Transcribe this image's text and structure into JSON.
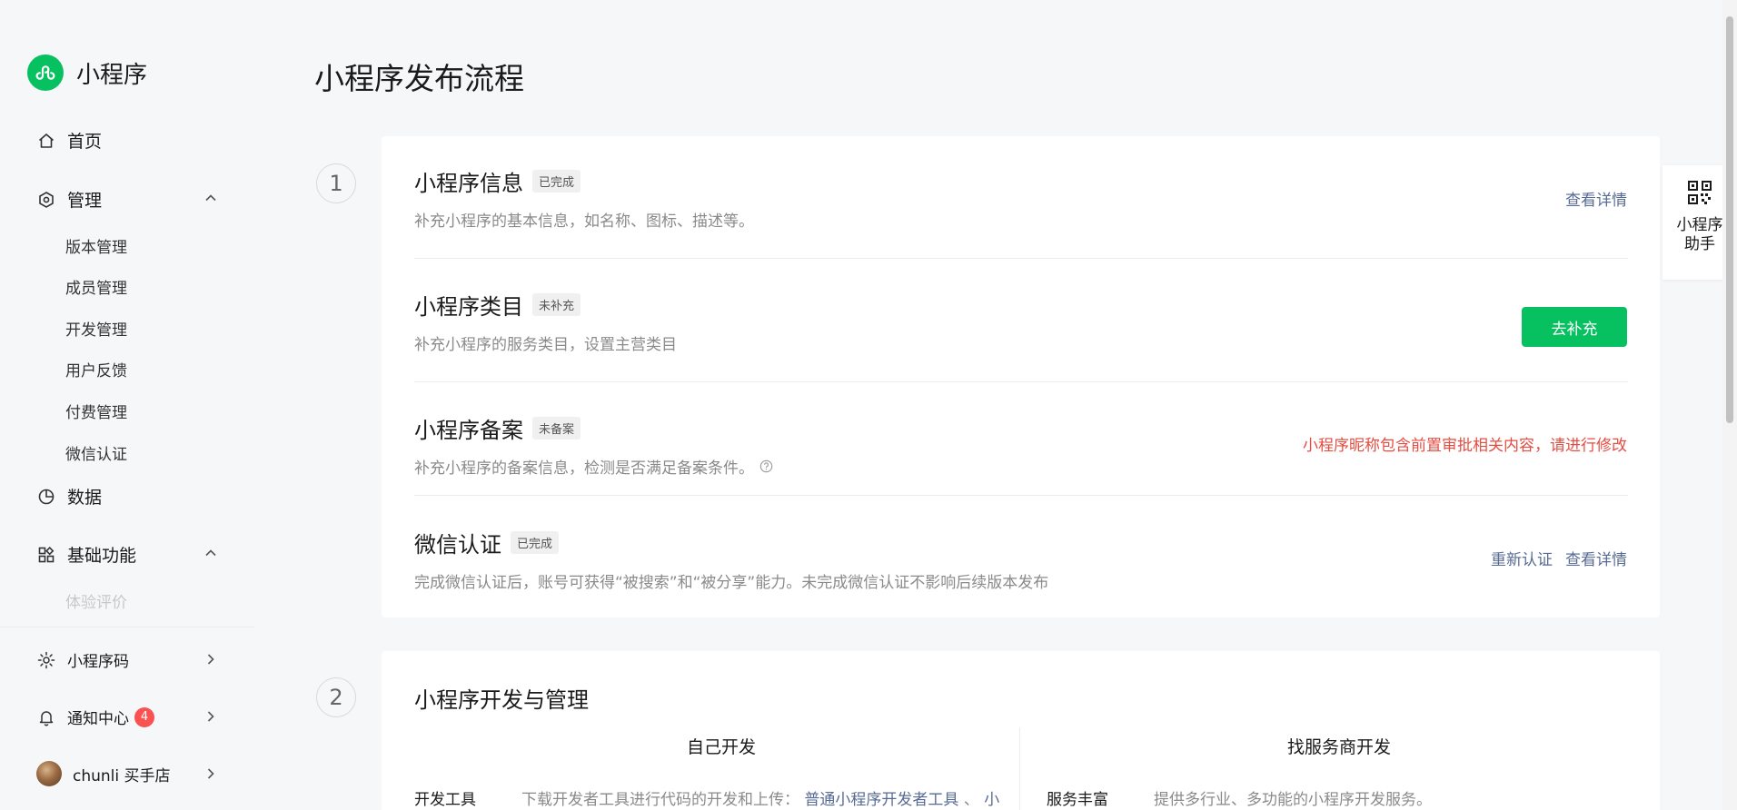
{
  "sidebar": {
    "logo_text": "小程序",
    "nav": {
      "home": "首页",
      "manage": "管理",
      "manage_sub": [
        "版本管理",
        "成员管理",
        "开发管理",
        "用户反馈",
        "付费管理",
        "微信认证"
      ],
      "data": "数据",
      "basic": "基础功能",
      "basic_sub": [
        "体验评价"
      ]
    },
    "bottom": {
      "qrcode": "小程序码",
      "notify": "通知中心",
      "notify_badge": "4",
      "account": "chunli 买手店"
    }
  },
  "page_title": "小程序发布流程",
  "steps": [
    "1",
    "2"
  ],
  "section1": {
    "info": {
      "title": "小程序信息",
      "tag": "已完成",
      "desc": "补充小程序的基本信息，如名称、图标、描述等。",
      "action": "查看详情"
    },
    "category": {
      "title": "小程序类目",
      "tag": "未补充",
      "desc": "补充小程序的服务类目，设置主营类目",
      "action": "去补充"
    },
    "record": {
      "title": "小程序备案",
      "tag": "未备案",
      "desc": "补充小程序的备案信息，检测是否满足备案条件。",
      "warning": "小程序昵称包含前置审批相关内容，请进行修改"
    },
    "verify": {
      "title": "微信认证",
      "tag": "已完成",
      "desc": "完成微信认证后，账号可获得“被搜索”和“被分享”能力。未完成微信认证不影响后续版本发布",
      "action1": "重新认证",
      "action2": "查看详情"
    }
  },
  "section2": {
    "title": "小程序开发与管理",
    "self_dev": "自己开发",
    "vendor_dev": "找服务商开发",
    "tools_label": "开发工具",
    "tools_desc": "下载开发者工具进行代码的开发和上传：",
    "tools_link": "普通小程序开发者工具",
    "tools_sep": "、",
    "tools_link2": "小",
    "service_label": "服务丰富",
    "service_desc": "提供多行业、多功能的小程序开发服务。"
  },
  "helper": {
    "line1": "小程序",
    "line2": "助手"
  },
  "colors": {
    "accent": "#07c160",
    "link": "#576b95",
    "warning": "#e54d42",
    "badge": "#fa5151"
  }
}
